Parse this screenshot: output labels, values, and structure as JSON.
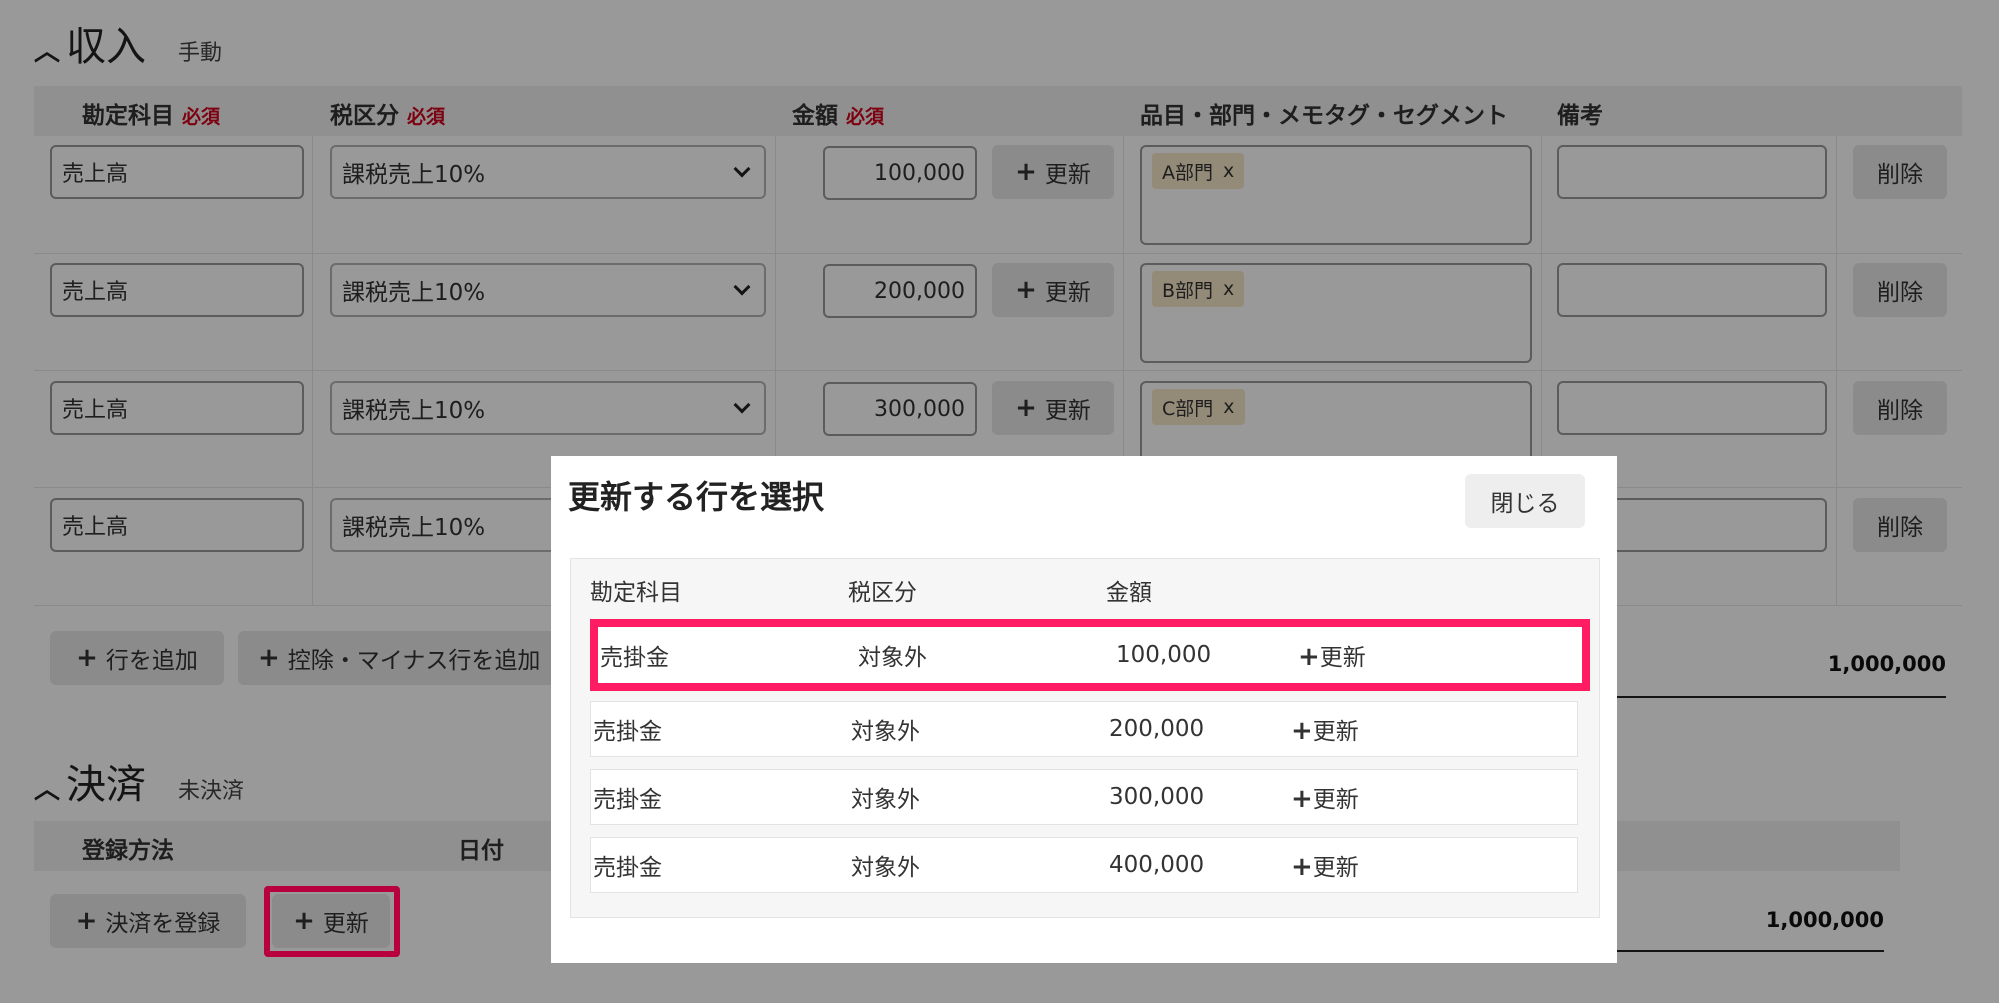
{
  "income": {
    "title": "収入",
    "subtitle": "手動",
    "headers": {
      "account": "勘定科目",
      "tax": "税区分",
      "amount": "金額",
      "required": "必須",
      "tags": "品目・部門・メモタグ・セグメント",
      "memo": "備考"
    },
    "rows": [
      {
        "account": "売上高",
        "tax": "課税売上10%",
        "amount": "100,000",
        "tag": "A部門"
      },
      {
        "account": "売上高",
        "tax": "課税売上10%",
        "amount": "200,000",
        "tag": "B部門"
      },
      {
        "account": "売上高",
        "tax": "課税売上10%",
        "amount": "300,000",
        "tag": "C部門"
      },
      {
        "account": "売上高",
        "tax": "課税売上10%",
        "amount": "",
        "tag": ""
      }
    ],
    "update_label": "更新",
    "delete_label": "削除",
    "tag_remove": "x",
    "add_row": "行を追加",
    "add_minus_row": "控除・マイナス行を追加",
    "total": "1,000,000"
  },
  "settlement": {
    "title": "決済",
    "subtitle": "未決済",
    "headers": {
      "method": "登録方法",
      "date": "日付"
    },
    "register": "決済を登録",
    "update": "更新",
    "total": "1,000,000"
  },
  "modal": {
    "title": "更新する行を選択",
    "close": "閉じる",
    "headers": {
      "account": "勘定科目",
      "tax": "税区分",
      "amount": "金額"
    },
    "rows": [
      {
        "account": "売掛金",
        "tax": "対象外",
        "amount": "100,000",
        "action": "更新"
      },
      {
        "account": "売掛金",
        "tax": "対象外",
        "amount": "200,000",
        "action": "更新"
      },
      {
        "account": "売掛金",
        "tax": "対象外",
        "amount": "300,000",
        "action": "更新"
      },
      {
        "account": "売掛金",
        "tax": "対象外",
        "amount": "400,000",
        "action": "更新"
      }
    ]
  },
  "colors": {
    "highlight": "#ff1c63",
    "highlight_dark": "#b8003e",
    "required": "#d0021b",
    "tag_bg": "#f5e7c9"
  }
}
